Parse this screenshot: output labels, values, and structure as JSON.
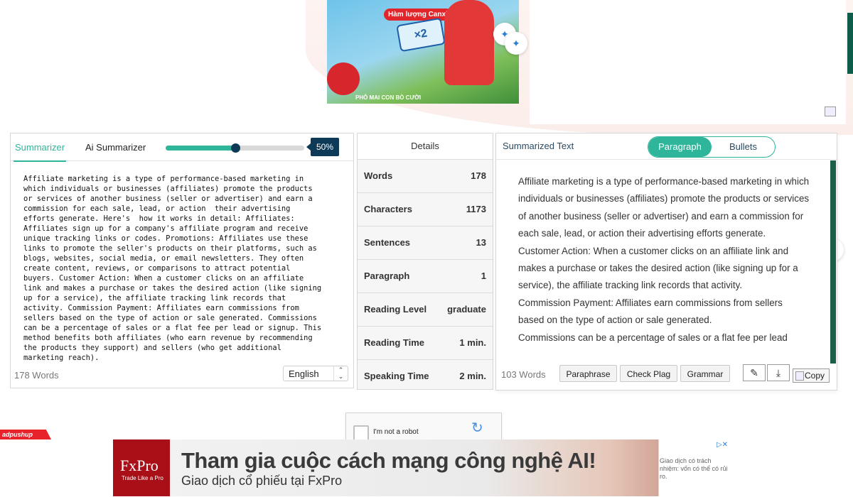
{
  "top_ad": {
    "badge_text": "Hàm lượng Canxi",
    "multiplier": "×2",
    "brand_text": "PHÔ MAI CON BÒ CƯỜI"
  },
  "tabs": {
    "summarizer": "Summarizer",
    "ai_summarizer": "Ai Summarizer"
  },
  "slider": {
    "value": 0.5,
    "label": "50%"
  },
  "input": {
    "text": "Affiliate marketing is a type of performance-based marketing in\nwhich individuals or businesses (affiliates) promote the products\nor services of another business (seller or advertiser) and earn a\ncommission for each sale, lead, or action  their advertising\nefforts generate. Here's  how it works in detail: Affiliates:\nAffiliates sign up for a company's affiliate program and receive\nunique tracking links or codes. Promotions: Affiliates use these\nlinks to promote the seller's products on their platforms, such as\nblogs, websites, social media, or email newsletters. They often\ncreate content, reviews, or comparisons to attract potential\nbuyers. Customer Action: When a customer clicks on an affiliate\nlink and makes a purchase or takes the desired action (like signing\nup for a service), the affiliate tracking link records that\nactivity. Commission Payment: Affiliates earn commissions from\nsellers based on the type of action or sale generated. Commissions\ncan be a percentage of sales or a flat fee per lead or signup. This\nmethod benefits both affiliates (who earn revenue by recommending\nthe products they support) and sellers (who get additional\nmarketing reach).",
    "word_count": "178 Words",
    "language": "English"
  },
  "details": {
    "title": "Details",
    "rows": [
      {
        "label": "Words",
        "value": "178"
      },
      {
        "label": "Characters",
        "value": "1173"
      },
      {
        "label": "Sentences",
        "value": "13"
      },
      {
        "label": "Paragraph",
        "value": "1"
      },
      {
        "label": "Reading Level",
        "value": "graduate"
      },
      {
        "label": "Reading Time",
        "value": "1 min."
      },
      {
        "label": "Speaking Time",
        "value": "2 min."
      }
    ]
  },
  "output": {
    "title": "Summarized Text",
    "toggle_paragraph": "Paragraph",
    "toggle_bullets": "Bullets",
    "paragraphs": [
      "Affiliate marketing is a type of performance-based marketing in which individuals or businesses (affiliates) promote the products or services of another business (seller or advertiser) and earn a commission for each sale, lead, or action their advertising efforts generate.",
      "Customer Action: When a customer clicks on an affiliate link and makes a purchase or takes the desired action (like signing up for a service), the affiliate tracking link records that activity.",
      "Commission Payment: Affiliates earn commissions from sellers based on the type of action or sale generated.",
      "Commissions can be a percentage of sales or a flat fee per lead"
    ],
    "word_count": "103 Words",
    "paraphrase_label": "Paraphrase",
    "check_plag_label": "Check Plag",
    "grammar_label": "Grammar",
    "copy_label": "Copy"
  },
  "captcha": {
    "label": "I'm not a robot"
  },
  "adpushup": "adpushup",
  "bottom_ad": {
    "brand": "FxPro",
    "tagline": "Trade Like a Pro",
    "headline": "Tham gia cuộc cách mạng công nghệ AI!",
    "subline": "Giao dịch cổ phiếu tại FxPro",
    "side_text": "Giao dịch có trách nhiệm: vốn có thể có rủi ro."
  },
  "colors": {
    "accent": "#2fb59a",
    "dark": "#0d3b57",
    "scroll": "#1b5e4a"
  }
}
